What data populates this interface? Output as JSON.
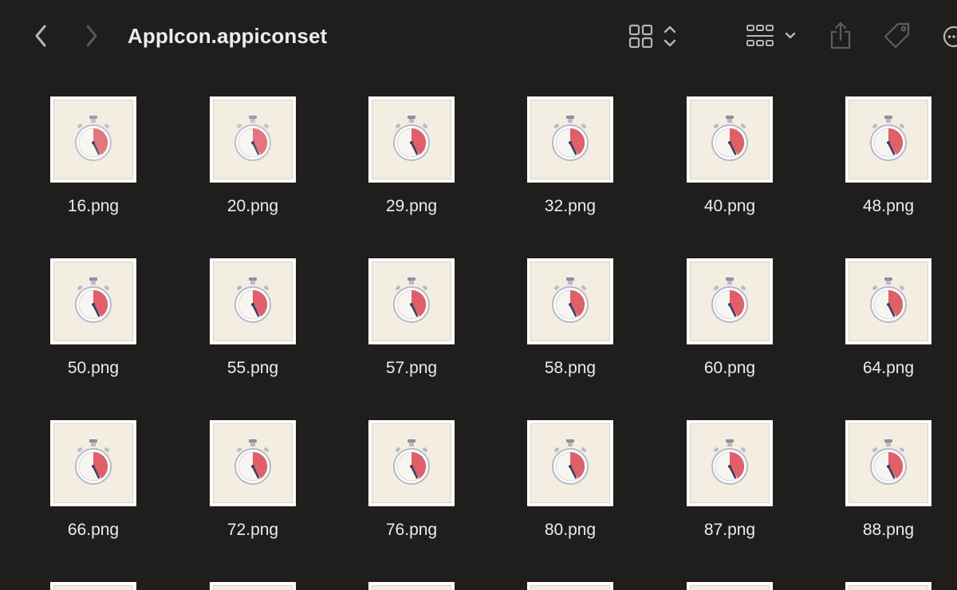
{
  "window": {
    "title": "AppIcon.appiconset"
  },
  "toolbar": {
    "back_icon": "chevron-left-icon",
    "forward_icon": "chevron-right-icon",
    "view_icon": "icon-grid-icon",
    "group_icon": "group-grid-icon",
    "share_icon": "share-icon",
    "tag_icon": "tag-icon",
    "more_icon": "more-icon"
  },
  "colors": {
    "background": "#1f1e1d",
    "thumb_bg": "#f3eee1",
    "accent_red": "#e0606a",
    "dial_navy": "#3a3f66"
  },
  "files": [
    {
      "name": "16.png"
    },
    {
      "name": "20.png"
    },
    {
      "name": "29.png"
    },
    {
      "name": "32.png"
    },
    {
      "name": "40.png"
    },
    {
      "name": "48.png"
    },
    {
      "name": "50.png"
    },
    {
      "name": "55.png"
    },
    {
      "name": "57.png"
    },
    {
      "name": "58.png"
    },
    {
      "name": "60.png"
    },
    {
      "name": "64.png"
    },
    {
      "name": "66.png"
    },
    {
      "name": "72.png"
    },
    {
      "name": "76.png"
    },
    {
      "name": "80.png"
    },
    {
      "name": "87.png"
    },
    {
      "name": "88.png"
    }
  ]
}
